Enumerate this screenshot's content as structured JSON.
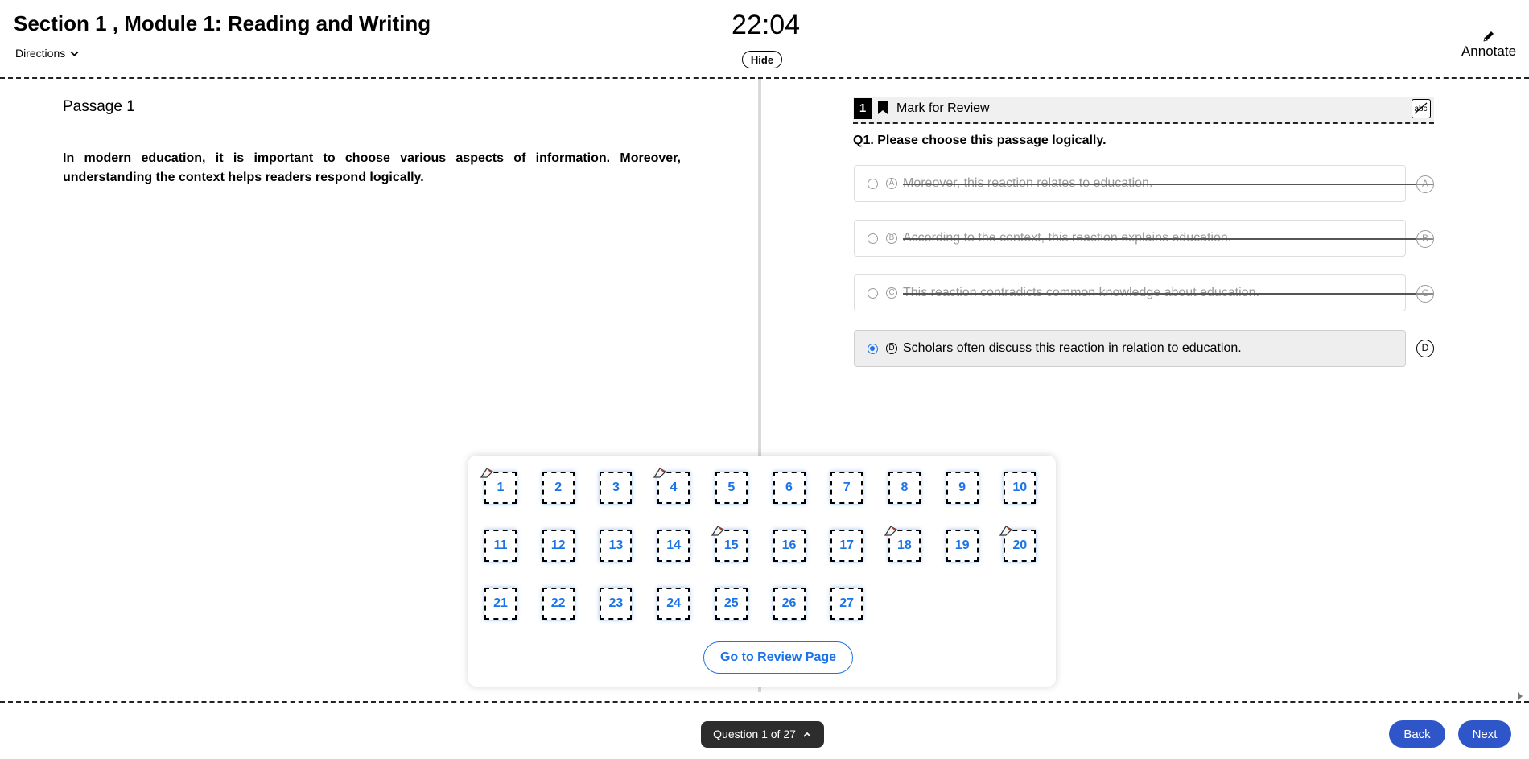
{
  "header": {
    "title": "Section 1 , Module 1: Reading and Writing",
    "directions_label": "Directions",
    "timer": "22:04",
    "hide_label": "Hide",
    "annotate_label": "Annotate"
  },
  "passage": {
    "title": "Passage 1",
    "text": "In modern education, it is important to choose various aspects of information. Moreover, understanding the context helps readers respond logically."
  },
  "question": {
    "number": "1",
    "mark_label": "Mark for Review",
    "text": "Q1. Please choose this passage logically.",
    "options": [
      {
        "letter": "A",
        "text": "Moreover, this reaction relates to education.",
        "eliminated": true,
        "selected": false
      },
      {
        "letter": "B",
        "text": "According to the context, this reaction explains education.",
        "eliminated": true,
        "selected": false
      },
      {
        "letter": "C",
        "text": "This reaction contradicts common knowledge about education.",
        "eliminated": true,
        "selected": false
      },
      {
        "letter": "D",
        "text": "Scholars often discuss this reaction in relation to education.",
        "eliminated": false,
        "selected": true
      }
    ]
  },
  "navigator": {
    "questions": [
      "1",
      "2",
      "3",
      "4",
      "5",
      "6",
      "7",
      "8",
      "9",
      "10",
      "11",
      "12",
      "13",
      "14",
      "15",
      "16",
      "17",
      "18",
      "19",
      "20",
      "21",
      "22",
      "23",
      "24",
      "25",
      "26",
      "27"
    ],
    "flagged": [
      "1",
      "4",
      "15",
      "18",
      "20"
    ],
    "review_label": "Go to Review Page"
  },
  "footer": {
    "counter": "Question 1 of 27",
    "back_label": "Back",
    "next_label": "Next"
  },
  "colors": {
    "accent": "#1a73e8",
    "nav_button": "#2f56c9",
    "counter_bg": "#2d2d2d"
  },
  "icons": [
    "chevron-down-icon",
    "pencil-icon",
    "bookmark-icon",
    "strikethrough-abc-icon",
    "flag-icon",
    "chevron-up-icon"
  ]
}
